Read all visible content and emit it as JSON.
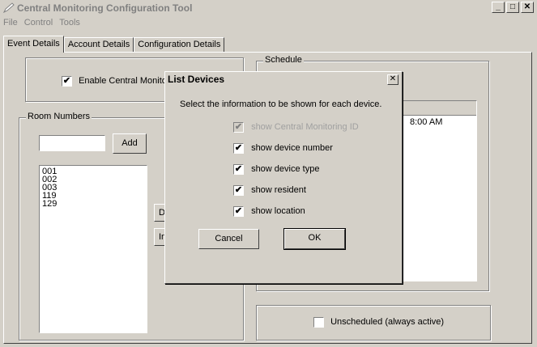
{
  "window": {
    "title": "Central Monitoring Configuration Tool",
    "minimize_glyph": "_",
    "maximize_glyph": "□",
    "close_glyph": "✕"
  },
  "menu": [
    {
      "label": "File"
    },
    {
      "label": "Control"
    },
    {
      "label": "Tools"
    }
  ],
  "tabs": [
    {
      "label": "Event Details",
      "active": true
    },
    {
      "label": "Account Details",
      "active": false
    },
    {
      "label": "Configuration Details",
      "active": false
    }
  ],
  "event_details": {
    "enable_label": "Enable Central Monitor",
    "enable_checked": true,
    "room_numbers": {
      "title": "Room Numbers",
      "input_value": "",
      "add_label": "Add",
      "rooms": [
        "001",
        "002",
        "003",
        "119",
        "129"
      ],
      "hidden_button_1": "D",
      "hidden_button_2": "In"
    },
    "schedule": {
      "title": "Schedule",
      "entry": "8:00 AM"
    },
    "unscheduled_label": "Unscheduled (always active)",
    "unscheduled_checked": false
  },
  "dialog": {
    "title": "List Devices",
    "close_glyph": "✕",
    "instruction": "Select the information to be shown for each device.",
    "options": [
      {
        "label": "show Central Monitoring ID",
        "checked": true,
        "disabled": true
      },
      {
        "label": "show device number",
        "checked": true,
        "disabled": false
      },
      {
        "label": "show device type",
        "checked": true,
        "disabled": false
      },
      {
        "label": "show resident",
        "checked": true,
        "disabled": false
      },
      {
        "label": "show location",
        "checked": true,
        "disabled": false
      }
    ],
    "cancel_label": "Cancel",
    "ok_label": "OK"
  },
  "check_glyph": "✔",
  "colors": {
    "face": "#d4d0c8",
    "disabled_text": "#808080"
  }
}
